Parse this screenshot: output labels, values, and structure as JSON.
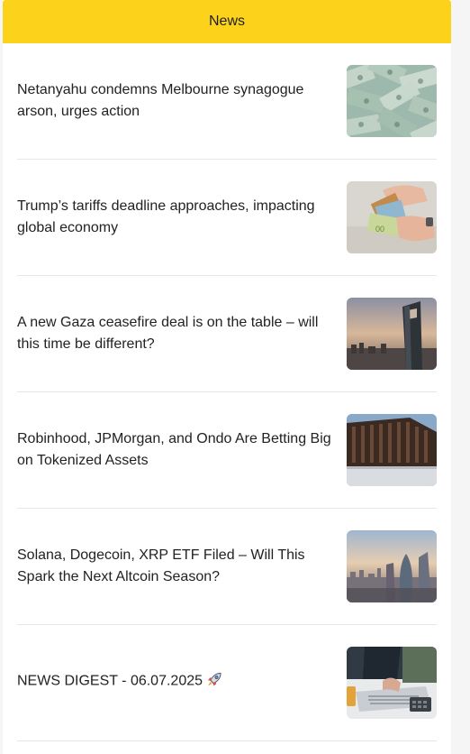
{
  "header": {
    "title": "News"
  },
  "items": [
    {
      "title": "Netanyahu condemns Melbourne synagogue arson, urges action",
      "thumbnail": "dollar-bills-image"
    },
    {
      "title": "Trump’s tariffs deadline approaches, impacting global economy",
      "thumbnail": "money-counting-hands-image"
    },
    {
      "title": "A new Gaza ceasefire deal is on the table – will this time be different?",
      "thumbnail": "skyscraper-city-image"
    },
    {
      "title": "Robinhood, JPMorgan, and Ondo Are Betting Big on Tokenized Assets",
      "thumbnail": "modern-building-facade-image"
    },
    {
      "title": "Solana, Dogecoin, XRP ETF Filed – Will This Spark the Next Altcoin Season?",
      "thumbnail": "london-skyline-image"
    },
    {
      "title": "NEWS DIGEST - 06.07.2025",
      "thumbnail": "desk-laptop-calculator-image",
      "emoji": "rocket-icon"
    }
  ],
  "colors": {
    "header_bg": "#fdd21b",
    "text": "#222222",
    "divider": "#e6e6e6"
  }
}
